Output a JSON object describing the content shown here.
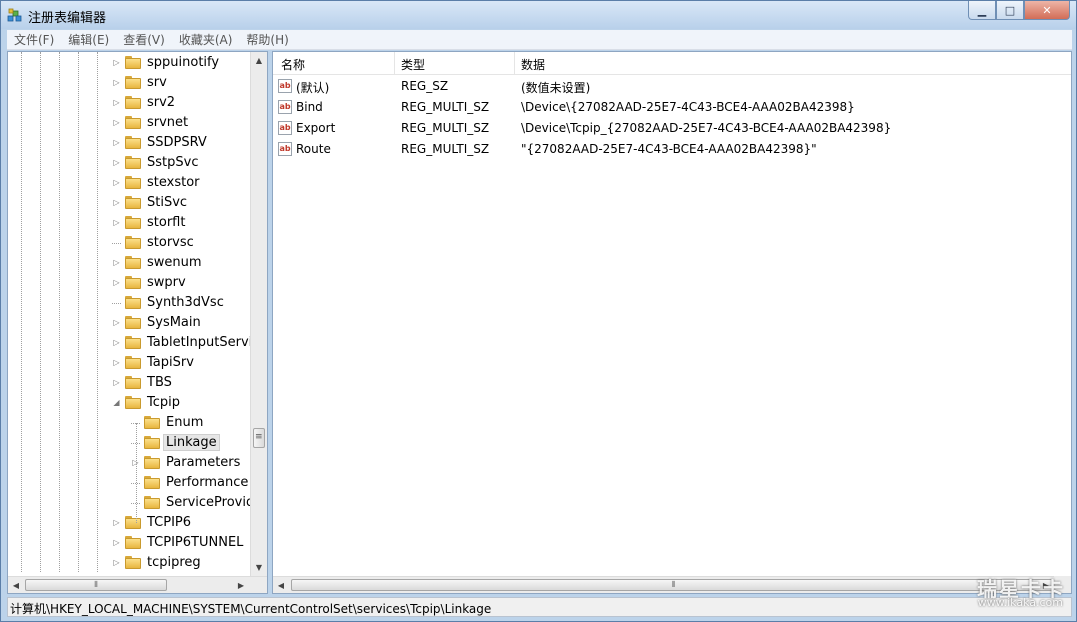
{
  "window": {
    "title": "注册表编辑器",
    "minimize_glyph": "▁",
    "maximize_glyph": "□",
    "close_glyph": "✕"
  },
  "menu": [
    "文件(F)",
    "编辑(E)",
    "查看(V)",
    "收藏夹(A)",
    "帮助(H)"
  ],
  "tree": {
    "items": [
      {
        "label": "sppuinotify",
        "level": 0,
        "expander": "collapsed"
      },
      {
        "label": "srv",
        "level": 0,
        "expander": "collapsed"
      },
      {
        "label": "srv2",
        "level": 0,
        "expander": "collapsed"
      },
      {
        "label": "srvnet",
        "level": 0,
        "expander": "collapsed"
      },
      {
        "label": "SSDPSRV",
        "level": 0,
        "expander": "collapsed"
      },
      {
        "label": "SstpSvc",
        "level": 0,
        "expander": "collapsed"
      },
      {
        "label": "stexstor",
        "level": 0,
        "expander": "collapsed"
      },
      {
        "label": "StiSvc",
        "level": 0,
        "expander": "collapsed"
      },
      {
        "label": "storflt",
        "level": 0,
        "expander": "collapsed"
      },
      {
        "label": "storvsc",
        "level": 0,
        "expander": "none"
      },
      {
        "label": "swenum",
        "level": 0,
        "expander": "collapsed"
      },
      {
        "label": "swprv",
        "level": 0,
        "expander": "collapsed"
      },
      {
        "label": "Synth3dVsc",
        "level": 0,
        "expander": "none"
      },
      {
        "label": "SysMain",
        "level": 0,
        "expander": "collapsed"
      },
      {
        "label": "TabletInputService",
        "level": 0,
        "expander": "collapsed"
      },
      {
        "label": "TapiSrv",
        "level": 0,
        "expander": "collapsed"
      },
      {
        "label": "TBS",
        "level": 0,
        "expander": "collapsed"
      },
      {
        "label": "Tcpip",
        "level": 0,
        "expander": "expanded"
      },
      {
        "label": "Enum",
        "level": 1,
        "expander": "none"
      },
      {
        "label": "Linkage",
        "level": 1,
        "expander": "none",
        "selected": true
      },
      {
        "label": "Parameters",
        "level": 1,
        "expander": "collapsed"
      },
      {
        "label": "Performance",
        "level": 1,
        "expander": "none"
      },
      {
        "label": "ServiceProvider",
        "level": 1,
        "expander": "none"
      },
      {
        "label": "TCPIP6",
        "level": 0,
        "expander": "collapsed"
      },
      {
        "label": "TCPIP6TUNNEL",
        "level": 0,
        "expander": "collapsed"
      },
      {
        "label": "tcpipreg",
        "level": 0,
        "expander": "collapsed"
      }
    ]
  },
  "scroll_glyphs": {
    "up": "▲",
    "down": "▼",
    "left": "◀",
    "right": "▶",
    "grip_v": "≡",
    "grip_h": "⦀"
  },
  "values": {
    "columns": [
      "名称",
      "类型",
      "数据"
    ],
    "icon_text": "ab",
    "rows": [
      {
        "name": "(默认)",
        "type": "REG_SZ",
        "data": "(数值未设置)"
      },
      {
        "name": "Bind",
        "type": "REG_MULTI_SZ",
        "data": "\\Device\\{27082AAD-25E7-4C43-BCE4-AAA02BA42398}"
      },
      {
        "name": "Export",
        "type": "REG_MULTI_SZ",
        "data": "\\Device\\Tcpip_{27082AAD-25E7-4C43-BCE4-AAA02BA42398}"
      },
      {
        "name": "Route",
        "type": "REG_MULTI_SZ",
        "data": "\"{27082AAD-25E7-4C43-BCE4-AAA02BA42398}\""
      }
    ]
  },
  "status": {
    "path": "计算机\\HKEY_LOCAL_MACHINE\\SYSTEM\\CurrentControlSet\\services\\Tcpip\\Linkage"
  },
  "watermark": {
    "line1": "瑞星卡卡",
    "line2": "www.ikaka.com"
  }
}
